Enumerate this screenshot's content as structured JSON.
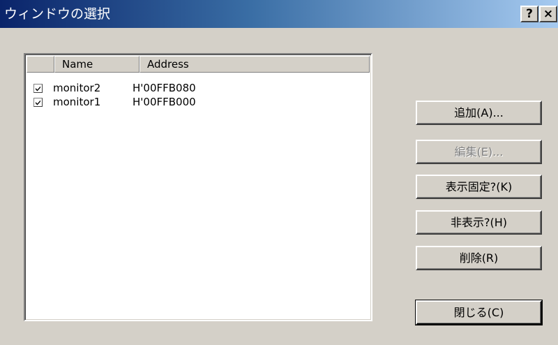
{
  "window": {
    "title": "ウィンドウの選択",
    "help_button": "?",
    "close_button": "×"
  },
  "list": {
    "columns": [
      "",
      "Name",
      "Address"
    ],
    "rows": [
      {
        "checked": true,
        "name": "monitor2",
        "address": "H'00FFB080"
      },
      {
        "checked": true,
        "name": "monitor1",
        "address": "H'00FFB000"
      }
    ]
  },
  "buttons": {
    "add": "追加(A)...",
    "edit": "編集(E)...",
    "fix": "表示固定?(K)",
    "hide": "非表示?(H)",
    "delete": "削除(R)",
    "close": "閉じる(C)"
  },
  "state": {
    "edit_disabled": true,
    "default_button": "close"
  }
}
